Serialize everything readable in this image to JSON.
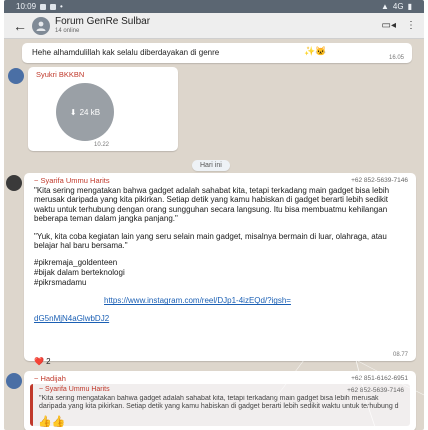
{
  "status_bar": {
    "time": "10:09",
    "right": "4G"
  },
  "header": {
    "title": "Forum GenRe Sulbar",
    "subtitle": "14 online"
  },
  "messages": {
    "top_text": "Hehe alhamdulillah kak selalu diberdayakan di genre",
    "top_emoji": "✨🐱",
    "top_time": "16.05",
    "audio_sender": "Syukri BKKBN",
    "audio_size": "24 kB",
    "audio_time": "10.22",
    "day_chip": "Hari ini",
    "main_sender": "~ Syarifa Ummu Harits",
    "main_phone": "+62 852-5639-7146",
    "main_p1": "\"Kita sering mengatakan bahwa gadget adalah sahabat kita, tetapi terkadang main gadget bisa lebih merusak daripada yang kita pikirkan. Setiap detik yang kamu habiskan di gadget berarti lebih sedikit waktu untuk terhubung dengan orang sungguhan secara langsung. Itu bisa membuatmu kehilangan beberapa teman dalam jangka panjang.\"",
    "main_p2": "\"Yuk, kita coba kegiatan lain yang seru selain main gadget, misalnya bermain di luar, olahraga, atau belajar hal baru bersama.\"",
    "hashtag_1": "#pikremaja_goldenteen",
    "hashtag_2": "#bijak dalam berteknologi",
    "hashtag_3": "#pikrsmadamu",
    "link_1": "https://www.instagram.com/reel/DJp1-4izEQd/?igsh=",
    "link_2": "dG5nMjN4aGlwbDJ2",
    "reaction": "❤️ 2",
    "main_time": "08.77",
    "reply_sender": "~ Hadijah",
    "reply_phone": "+62 851-6162-6951",
    "quote_sender": "~ Syarifa Ummu Harits",
    "quote_phone": "+62 852-5639-7146",
    "quote_text": "\"Kita sering mengatakan bahwa gadget adalah sahabat kita, tetapi terkadang main gadget bisa lebih merusak daripada yang kita pikirkan. Setiap detik yang kamu habiskan di gadget berarti lebih sedikit waktu untuk terhubung d",
    "reply_emoji": "👍👍"
  },
  "colors": {
    "sender": "#c0392b",
    "link": "#1a5fb4",
    "chat_bg": "#ddd6cc"
  }
}
